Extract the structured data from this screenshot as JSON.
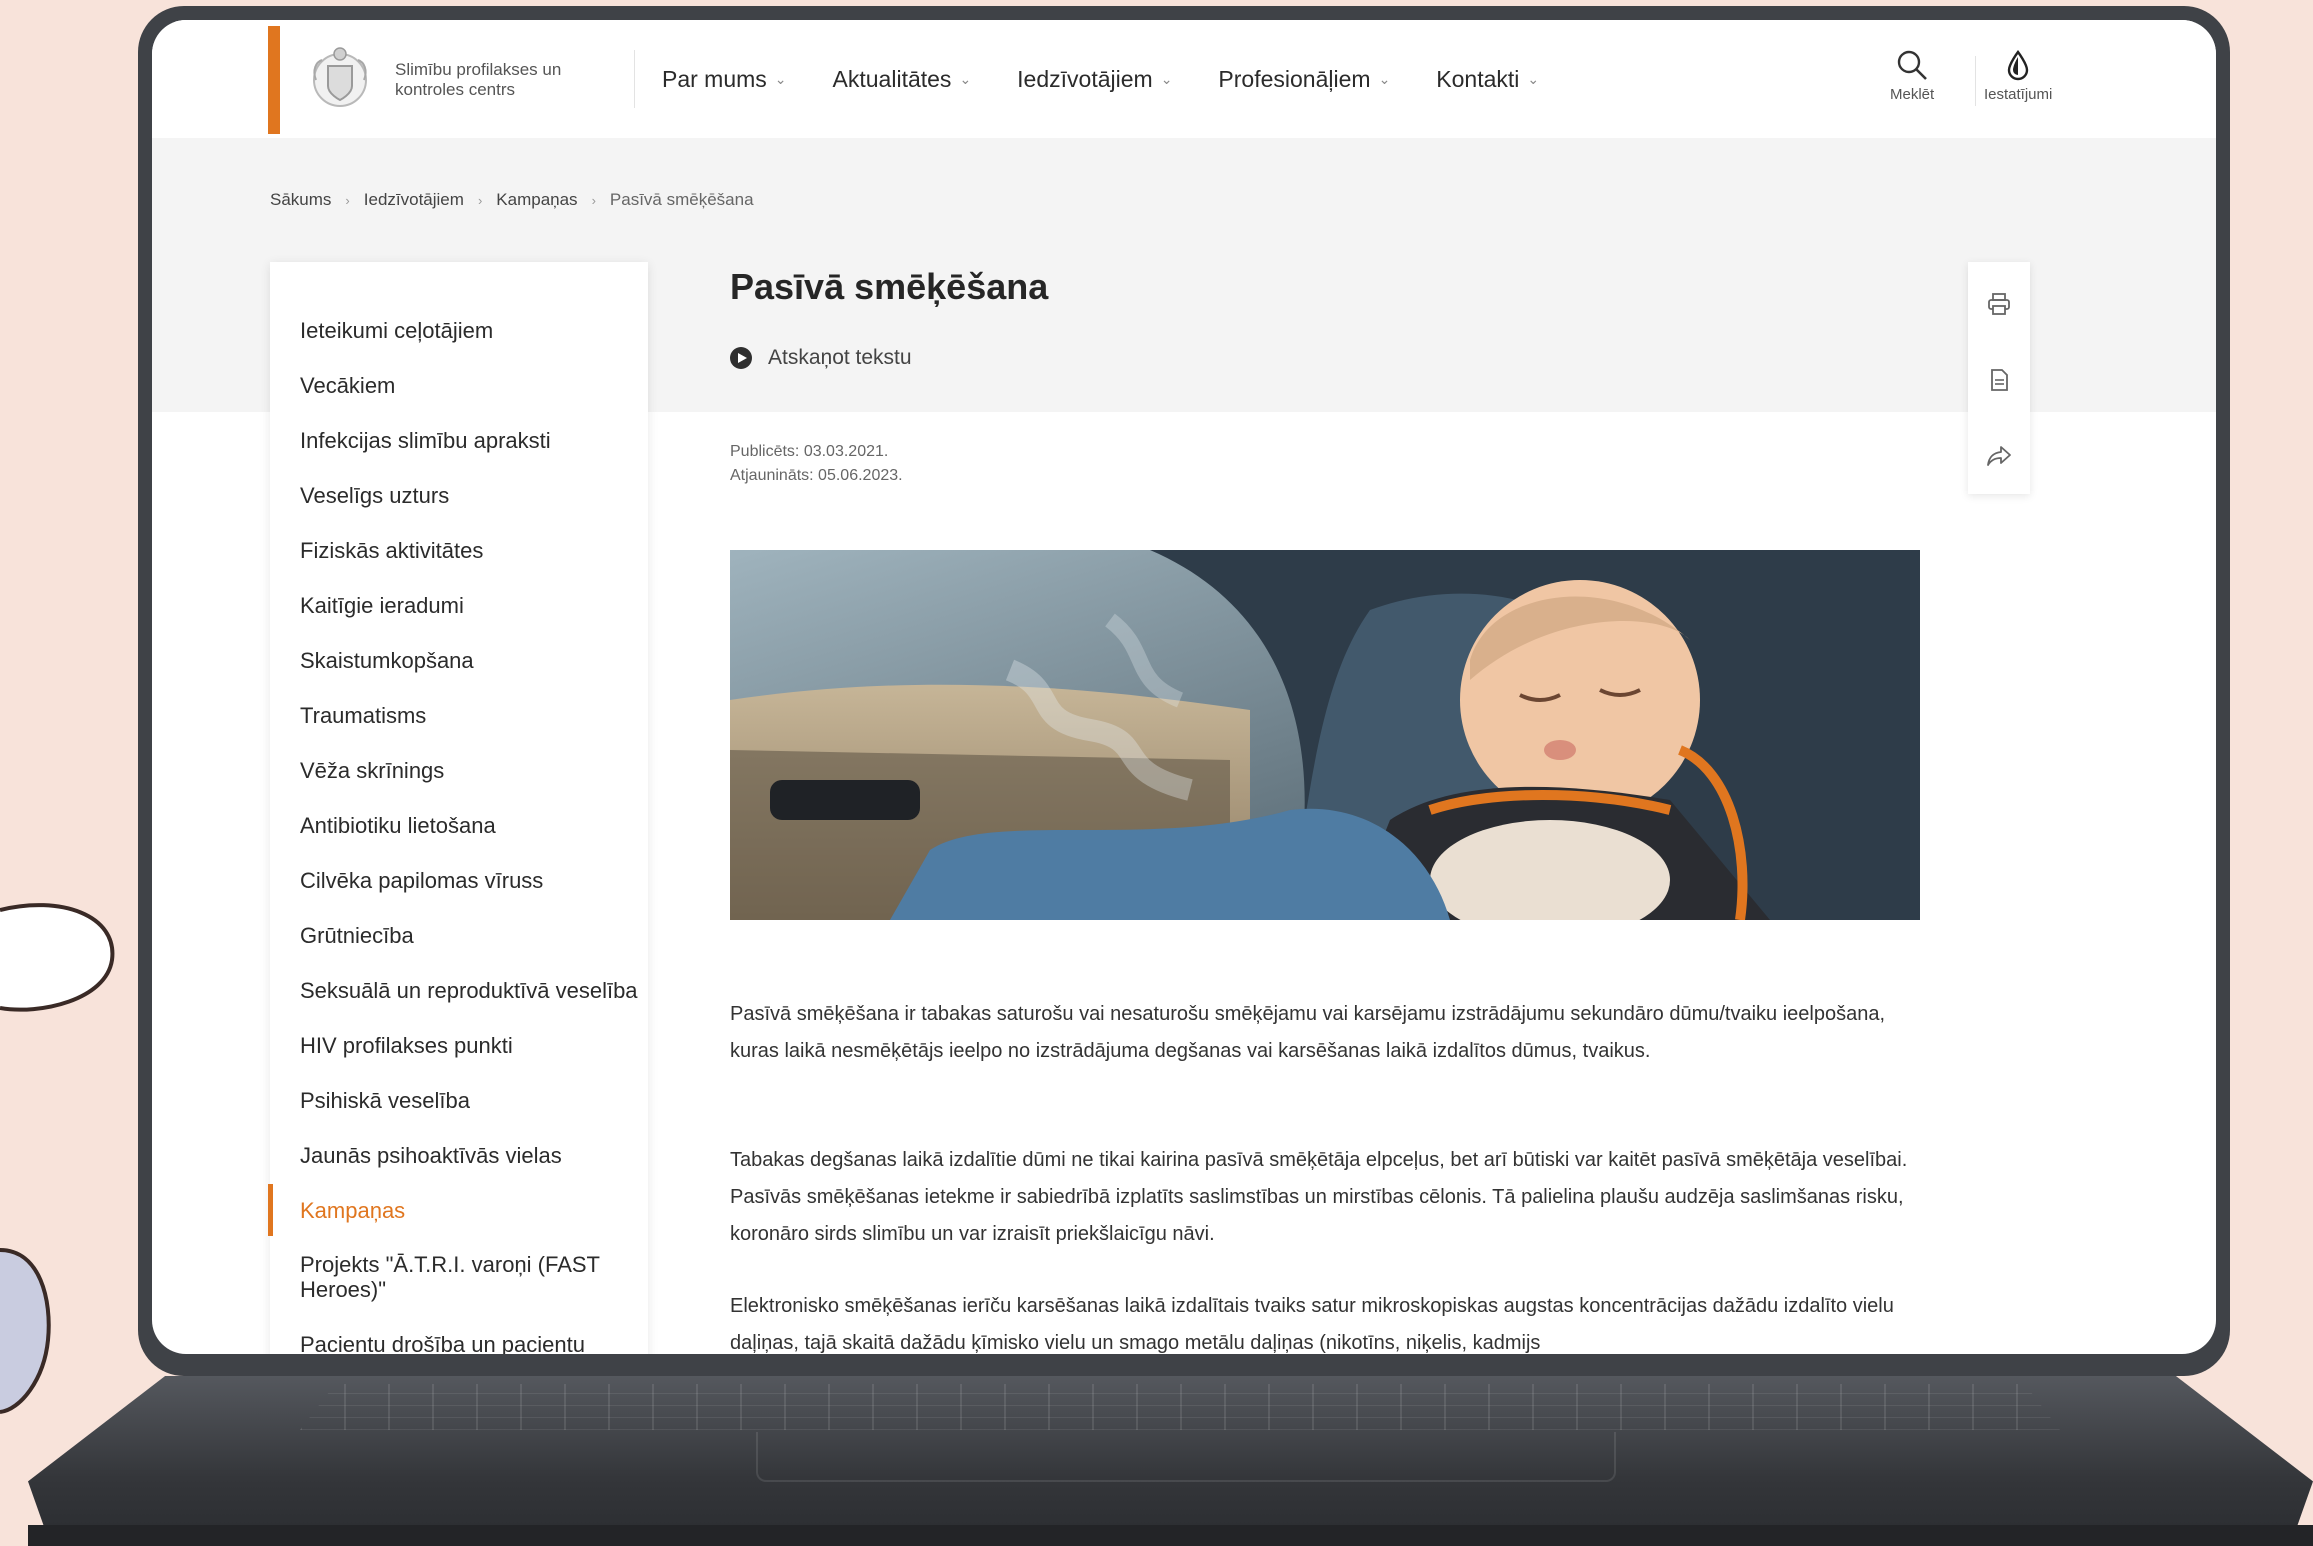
{
  "header": {
    "org_name": "Slimību profilakses un kontroles centrs",
    "nav": [
      {
        "label": "Par mums"
      },
      {
        "label": "Aktualitātes"
      },
      {
        "label": "Iedzīvotājiem"
      },
      {
        "label": "Profesionāļiem"
      },
      {
        "label": "Kontakti"
      }
    ],
    "search_label": "Meklēt",
    "settings_label": "Iestatījumi"
  },
  "breadcrumb": [
    "Sākums",
    "Iedzīvotājiem",
    "Kampaņas",
    "Pasīvā smēķēšana"
  ],
  "sidebar": {
    "items": [
      {
        "label": "Ieteikumi ceļotājiem"
      },
      {
        "label": "Vecākiem"
      },
      {
        "label": "Infekcijas slimību apraksti"
      },
      {
        "label": "Veselīgs uzturs"
      },
      {
        "label": "Fiziskās aktivitātes"
      },
      {
        "label": "Kaitīgie ieradumi"
      },
      {
        "label": "Skaistumkopšana"
      },
      {
        "label": "Traumatisms"
      },
      {
        "label": "Vēža skrīnings"
      },
      {
        "label": "Antibiotiku lietošana"
      },
      {
        "label": "Cilvēka papilomas vīruss"
      },
      {
        "label": "Grūtniecība"
      },
      {
        "label": "Seksuālā un reproduktīvā veselība"
      },
      {
        "label": "HIV profilakses punkti"
      },
      {
        "label": "Psihiskā veselība"
      },
      {
        "label": "Jaunās psihoaktīvās vielas"
      },
      {
        "label": "Kampaņas",
        "active": true
      },
      {
        "label": "Projekts \"Ā.T.R.I. varoņi (FAST Heroes)\""
      },
      {
        "label": "Pacientu drošība un pacientu pieredzes mērījumi"
      }
    ]
  },
  "article": {
    "title": "Pasīvā smēķēšana",
    "listen_label": "Atskaņot tekstu",
    "published": "Publicēts: 03.03.2021.",
    "updated": "Atjaunināts: 05.06.2023.",
    "paragraphs": [
      "Pasīvā smēķēšana ir tabakas saturošu vai nesaturošu smēķējamu vai karsējamu izstrādājumu sekundāro dūmu/tvaiku ieelpošana, kuras laikā nesmēķētājs ieelpo no izstrādājuma degšanas vai karsēšanas laikā izdalītos dūmus, tvaikus.",
      "Tabakas degšanas laikā izdalītie dūmi ne tikai kairina pasīvā smēķētāja elpceļus, bet arī būtiski var kaitēt pasīvā smēķētāja veselībai. Pasīvās smēķēšanas ietekme ir sabiedrībā izplatīts saslimstības un mirstības cēlonis. Tā palielina plaušu audzēja saslimšanas risku, koronāro sirds slimību un var izraisīt priekšlaicīgu nāvi.",
      "Elektronisko smēķēšanas ierīču karsēšanas laikā izdalītais tvaiks satur mikroskopiskas augstas koncentrācijas dažādu izdalīto vielu daļiņas, tajā skaitā dažādu ķīmisko vielu un smago metālu daļiņas (nikotīns, niķelis, kadmijs"
    ]
  },
  "colors": {
    "accent": "#e0761f",
    "background": "#f8e3da",
    "laptop": "#3f4247"
  },
  "icons": [
    "search-icon",
    "drop-icon",
    "print-icon",
    "document-icon",
    "share-icon",
    "play-icon"
  ]
}
